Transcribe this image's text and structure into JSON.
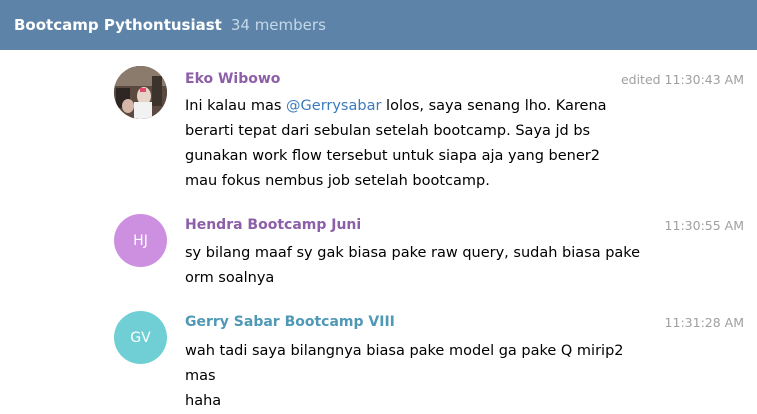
{
  "header": {
    "title": "Bootcamp Pythontusiast",
    "members": "34 members"
  },
  "messages": [
    {
      "sender": "Eko Wibowo",
      "sender_color": "#8c5fa8",
      "time": "edited 11:30:43 AM",
      "avatar": "photo",
      "text_before": "Ini kalau mas ",
      "mention": "@Gerrysabar",
      "text_after": " lolos, saya senang lho. Karena\nberarti tepat dari sebulan setelah bootcamp. Saya jd bs\ngunakan work flow tersebut untuk siapa aja yang bener2\nmau fokus nembus job setelah bootcamp."
    },
    {
      "sender": "Hendra Bootcamp Juni",
      "sender_color": "#8c5fa8",
      "time": "11:30:55 AM",
      "avatar_initials": "HJ",
      "avatar_color": "#cd8fe0",
      "text": "sy bilang maaf sy gak biasa pake raw query, sudah biasa pake\norm soalnya"
    },
    {
      "sender": "Gerry Sabar Bootcamp VIII",
      "sender_color": "#4f98b6",
      "time": "11:31:28 AM",
      "avatar_initials": "GV",
      "avatar_color": "#6fcfd5",
      "text": "wah tadi saya bilangnya biasa pake model ga pake Q mirip2 mas\nhaha"
    }
  ]
}
